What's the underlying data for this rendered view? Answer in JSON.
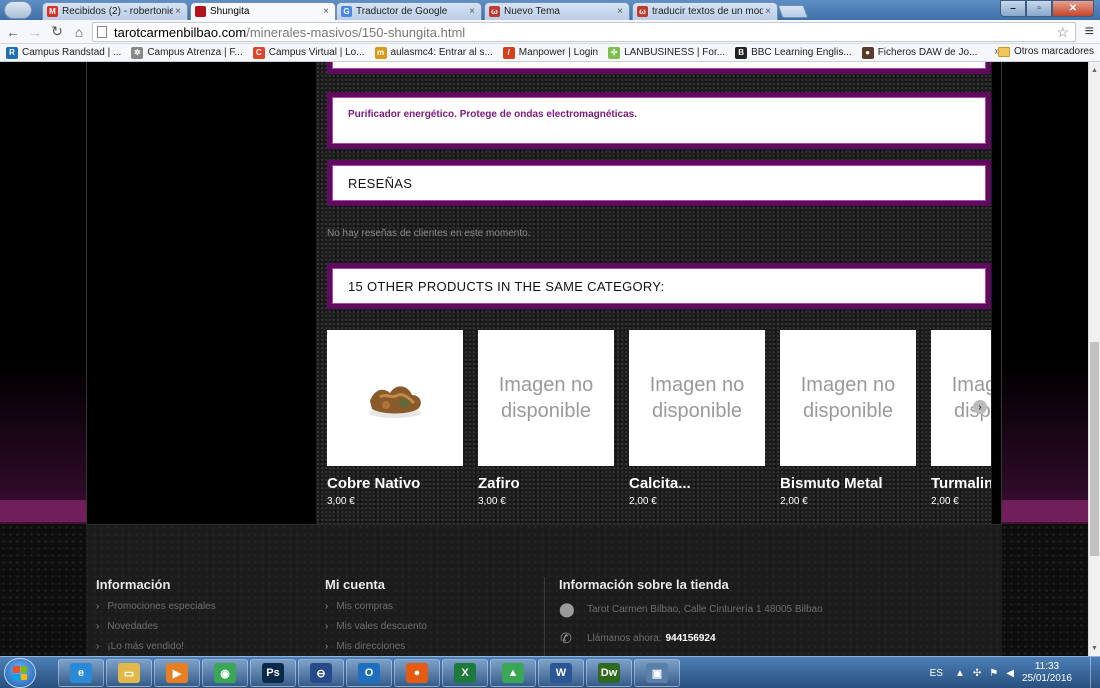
{
  "browser": {
    "tabs": [
      {
        "title": "Recibidos (2) - robertonie",
        "favicon": "gmail-icon",
        "favicon_text": "M",
        "favicon_color": "#d93025",
        "active": false
      },
      {
        "title": "Shungita",
        "favicon": "site-icon",
        "favicon_text": "",
        "favicon_color": "#b5121b",
        "active": true
      },
      {
        "title": "Traductor de Google",
        "favicon": "translate-icon",
        "favicon_text": "G",
        "favicon_color": "#4a86e8",
        "active": false
      },
      {
        "title": "Nuevo Tema",
        "favicon": "forum-icon",
        "favicon_text": "ω",
        "favicon_color": "#c0392b",
        "active": false
      },
      {
        "title": "traducir textos de un mod",
        "favicon": "forum-icon",
        "favicon_text": "ω",
        "favicon_color": "#c0392b",
        "active": false
      }
    ],
    "url_host": "tarotcarmenbilbao.com",
    "url_path": "/minerales-masivos/150-shungita.html",
    "bookmarks": [
      {
        "label": "Campus Randstad | ...",
        "color": "#1f6fb5",
        "glyph": "R"
      },
      {
        "label": "Campus Atrenza | F...",
        "color": "#888888",
        "glyph": "✲"
      },
      {
        "label": "Campus Virtual | Lo...",
        "color": "#e0452b",
        "glyph": "C"
      },
      {
        "label": "aulasmc4: Entrar al s...",
        "color": "#d89a1b",
        "glyph": "m"
      },
      {
        "label": "Manpower | Login",
        "color": "#d2401e",
        "glyph": "/"
      },
      {
        "label": "LANBUSINESS | For...",
        "color": "#7bbf4d",
        "glyph": "✣"
      },
      {
        "label": "BBC Learning Englis...",
        "color": "#222222",
        "glyph": "B"
      },
      {
        "label": "Ficheros DAW de Jo...",
        "color": "#5a3a2a",
        "glyph": "●"
      }
    ],
    "bookmarks_more": "»",
    "other_bookmarks": "Otros marcadores"
  },
  "product": {
    "description": "Purificador energético. Protege de ondas electromagnéticas.",
    "reviews_title": "RESEÑAS",
    "no_reviews": "No hay reseñas de clientes en este momento.",
    "related_title": "15 OTHER PRODUCTS IN THE SAME CATEGORY:"
  },
  "related_products": [
    {
      "name": "Cobre Nativo",
      "price": "3,00 €",
      "image_text": "",
      "has_photo": true
    },
    {
      "name": "Zafiro",
      "price": "3,00 €",
      "image_text": "Imagen no disponible",
      "has_photo": false
    },
    {
      "name": "Calcita...",
      "price": "2,00 €",
      "image_text": "Imagen no disponible",
      "has_photo": false
    },
    {
      "name": "Bismuto Metal",
      "price": "2,00 €",
      "image_text": "Imagen no disponible",
      "has_photo": false
    },
    {
      "name": "Turmalin",
      "price": "2,00 €",
      "image_text": "Imagen no disponible",
      "has_photo": false
    }
  ],
  "footer": {
    "info": {
      "title": "Información",
      "links": [
        "Promociones especiales",
        "Novedades",
        "¡Lo más vendido!"
      ]
    },
    "account": {
      "title": "Mi cuenta",
      "links": [
        "Mis compras",
        "Mis vales descuento",
        "Mis direcciones"
      ]
    },
    "store": {
      "title": "Información sobre la tienda",
      "address": "Tarot Carmen Bilbao, Calle Cinturería 1 48005 Bilbao",
      "call_label": "Llámanos ahora:",
      "phone": "944156924"
    }
  },
  "taskbar": {
    "language": "ES",
    "time": "11:33",
    "date": "25/01/2016",
    "apps": [
      {
        "name": "ie-icon",
        "glyph": "e",
        "color": "#2a8ad8"
      },
      {
        "name": "explorer-icon",
        "glyph": "▭",
        "color": "#e1b94a"
      },
      {
        "name": "media-player-icon",
        "glyph": "▶",
        "color": "#e67e22"
      },
      {
        "name": "chrome-icon",
        "glyph": "◉",
        "color": "#3aa757"
      },
      {
        "name": "photoshop-icon",
        "glyph": "Ps",
        "color": "#0b2a4a"
      },
      {
        "name": "vpn-icon",
        "glyph": "⊖",
        "color": "#274b8a"
      },
      {
        "name": "outlook-icon",
        "glyph": "O",
        "color": "#1f6fbf"
      },
      {
        "name": "firefox-icon",
        "glyph": "●",
        "color": "#e55b13"
      },
      {
        "name": "excel-icon",
        "glyph": "X",
        "color": "#1d7a3a"
      },
      {
        "name": "network-icon",
        "glyph": "▲",
        "color": "#3aa757"
      },
      {
        "name": "word-icon",
        "glyph": "W",
        "color": "#2b5797"
      },
      {
        "name": "dreamweaver-icon",
        "glyph": "Dw",
        "color": "#2f6b1f"
      },
      {
        "name": "remote-desktop-icon",
        "glyph": "▣",
        "color": "#5a7fa8"
      }
    ]
  }
}
